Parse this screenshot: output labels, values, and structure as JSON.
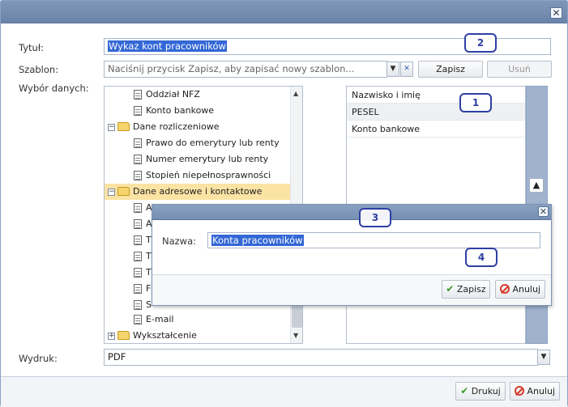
{
  "dialog": {
    "title_label": "Tytuł:",
    "title_value": "Wykaz kont pracowników",
    "template_label": "Szablon:",
    "template_placeholder": "Naciśnij przycisk Zapisz, aby zapisać nowy szablon...",
    "save_template_button": "Zapisz",
    "delete_template_button": "Usuń",
    "data_selection_label": "Wybór danych:",
    "output_label": "Wydruk:",
    "output_value": "PDF",
    "print_button": "Drukuj",
    "cancel_button": "Anuluj",
    "close_glyph": "✕"
  },
  "tree": {
    "items": [
      {
        "label": "Oddział NFZ",
        "type": "leaf"
      },
      {
        "label": "Konto bankowe",
        "type": "leaf"
      },
      {
        "label": "Dane rozliczeniowe",
        "type": "folder",
        "expanded": true
      },
      {
        "label": "Prawo do emerytury lub renty",
        "type": "leaf"
      },
      {
        "label": "Numer emerytury lub renty",
        "type": "leaf"
      },
      {
        "label": "Stopień niepełnosprawności",
        "type": "leaf"
      },
      {
        "label": "Dane adresowe i kontaktowe",
        "type": "folder",
        "expanded": true,
        "selected": true
      },
      {
        "label": "A",
        "type": "leaf"
      },
      {
        "label": "A",
        "type": "leaf"
      },
      {
        "label": "T",
        "type": "leaf"
      },
      {
        "label": "T",
        "type": "leaf"
      },
      {
        "label": "T",
        "type": "leaf"
      },
      {
        "label": "F",
        "type": "leaf"
      },
      {
        "label": "S",
        "type": "leaf"
      },
      {
        "label": "E-mail",
        "type": "leaf"
      },
      {
        "label": "Wykształcenie",
        "type": "folder",
        "expanded": false
      }
    ]
  },
  "selected_columns": [
    "Nazwisko i imię",
    "PESEL",
    "Konto bankowe"
  ],
  "callouts": [
    "1",
    "2",
    "3",
    "4"
  ],
  "modal": {
    "name_label": "Nazwa:",
    "name_value": "Konta pracowników",
    "save_button": "Zapisz",
    "cancel_button": "Anuluj"
  },
  "icons": {
    "move_up": "▲",
    "combo_arrow": "▼",
    "clear": "✕",
    "check": "✔",
    "minus": "−",
    "plus": "+"
  },
  "colors": {
    "titlebar": "#7089ad",
    "selection": "#3367d6",
    "tree_selected": "#fbe3a4",
    "callout": "#2f3fa3"
  }
}
